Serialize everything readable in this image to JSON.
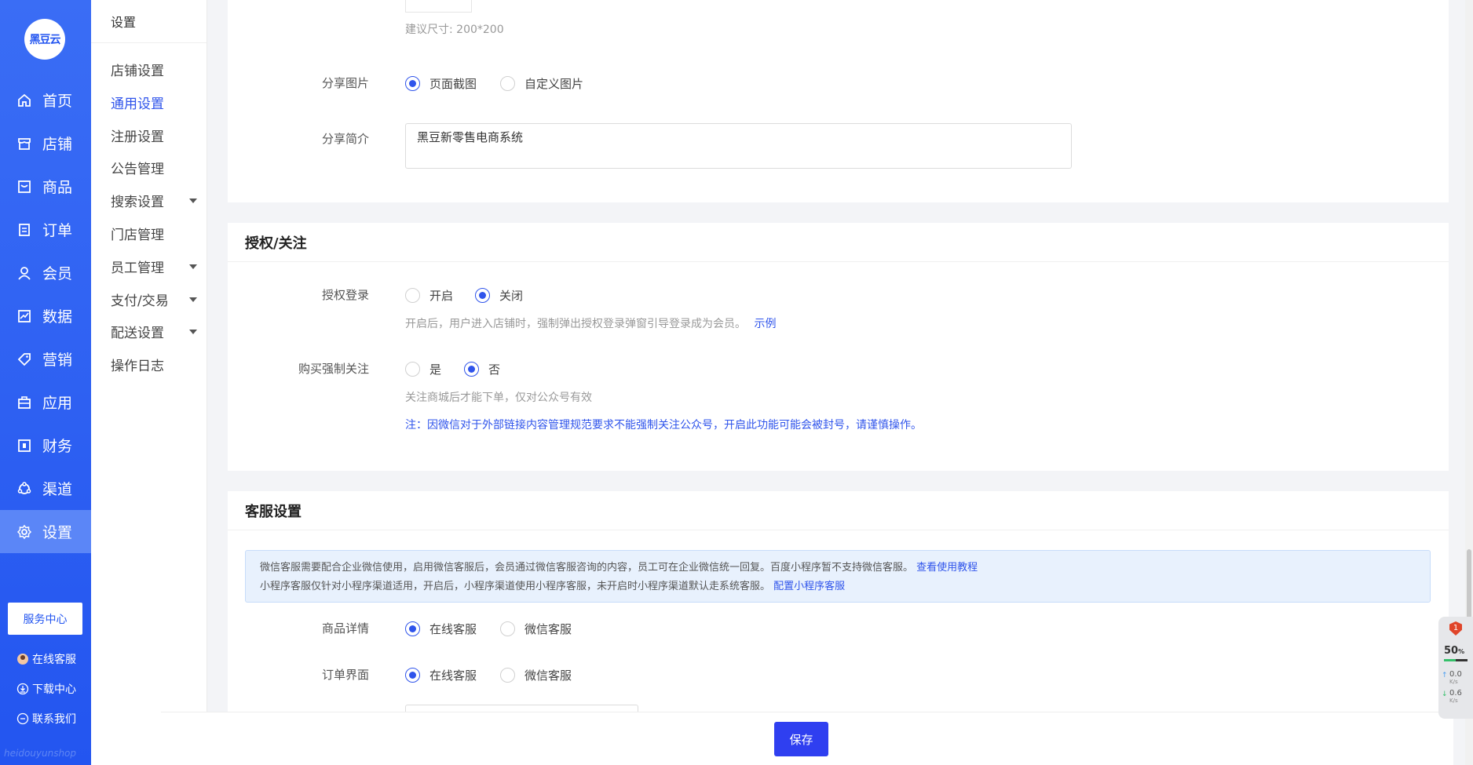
{
  "brand": {
    "logo_text": "黑豆云",
    "footer_text": "heidouyunshop"
  },
  "left_nav": {
    "items": [
      {
        "label": "首页",
        "icon": "home-icon"
      },
      {
        "label": "店铺",
        "icon": "store-icon"
      },
      {
        "label": "商品",
        "icon": "goods-icon"
      },
      {
        "label": "订单",
        "icon": "order-icon"
      },
      {
        "label": "会员",
        "icon": "member-icon"
      },
      {
        "label": "数据",
        "icon": "chart-icon"
      },
      {
        "label": "营销",
        "icon": "tag-icon"
      },
      {
        "label": "应用",
        "icon": "apps-icon"
      },
      {
        "label": "财务",
        "icon": "finance-icon"
      },
      {
        "label": "渠道",
        "icon": "channel-icon"
      },
      {
        "label": "设置",
        "icon": "gear-icon"
      }
    ],
    "active": "设置",
    "service_center": "服务中心",
    "online_service": "在线客服",
    "download_center": "下载中心",
    "contact_us": "联系我们"
  },
  "sub_nav": {
    "title": "设置",
    "items": [
      {
        "label": "店铺设置"
      },
      {
        "label": "通用设置"
      },
      {
        "label": "注册设置"
      },
      {
        "label": "公告管理"
      },
      {
        "label": "搜索设置"
      },
      {
        "label": "门店管理"
      },
      {
        "label": "员工管理"
      },
      {
        "label": "支付/交易"
      },
      {
        "label": "配送设置"
      },
      {
        "label": "操作日志"
      }
    ],
    "active": "通用设置"
  },
  "share": {
    "size_hint": "建议尺寸: 200*200",
    "image_label": "分享图片",
    "image_options": [
      "页面截图",
      "自定义图片"
    ],
    "image_selected": "页面截图",
    "intro_label": "分享简介",
    "intro_value": "黑豆新零售电商系统"
  },
  "auth": {
    "title": "授权/关注",
    "login_label": "授权登录",
    "login_options": [
      "开启",
      "关闭"
    ],
    "login_selected": "关闭",
    "login_hint": "开启后，用户进入店铺时，强制弹出授权登录弹窗引导登录成为会员。",
    "login_example": "示例",
    "follow_label": "购买强制关注",
    "follow_options": [
      "是",
      "否"
    ],
    "follow_selected": "否",
    "follow_hint": "关注商城后才能下单，仅对公众号有效",
    "follow_note": "注：因微信对于外部链接内容管理规范要求不能强制关注公众号，开启此功能可能会被封号，请谨慎操作。"
  },
  "service": {
    "title": "客服设置",
    "notice_line1": "微信客服需要配合企业微信使用，启用微信客服后，会员通过微信客服咨询的内容，员工可在企业微信统一回复。百度小程序暂不支持微信客服。",
    "notice_link1": "查看使用教程",
    "notice_line2": "小程序客服仅针对小程序渠道适用，开启后，小程序渠道使用小程序客服，未开启时小程序渠道默认走系统客服。",
    "notice_link2": "配置小程序客服",
    "goods_label": "商品详情",
    "goods_options": [
      "在线客服",
      "微信客服"
    ],
    "goods_selected": "在线客服",
    "order_label": "订单界面",
    "order_options": [
      "在线客服",
      "微信客服"
    ],
    "order_selected": "在线客服"
  },
  "footer": {
    "save_label": "保存"
  },
  "widget": {
    "badge": "1",
    "cpu": "50",
    "cpu_unit": "%",
    "up": "0.0",
    "down": "0.6",
    "unit": "K/s"
  },
  "colors": {
    "primary": "#2f54eb",
    "sidebar": "#2355f0"
  }
}
